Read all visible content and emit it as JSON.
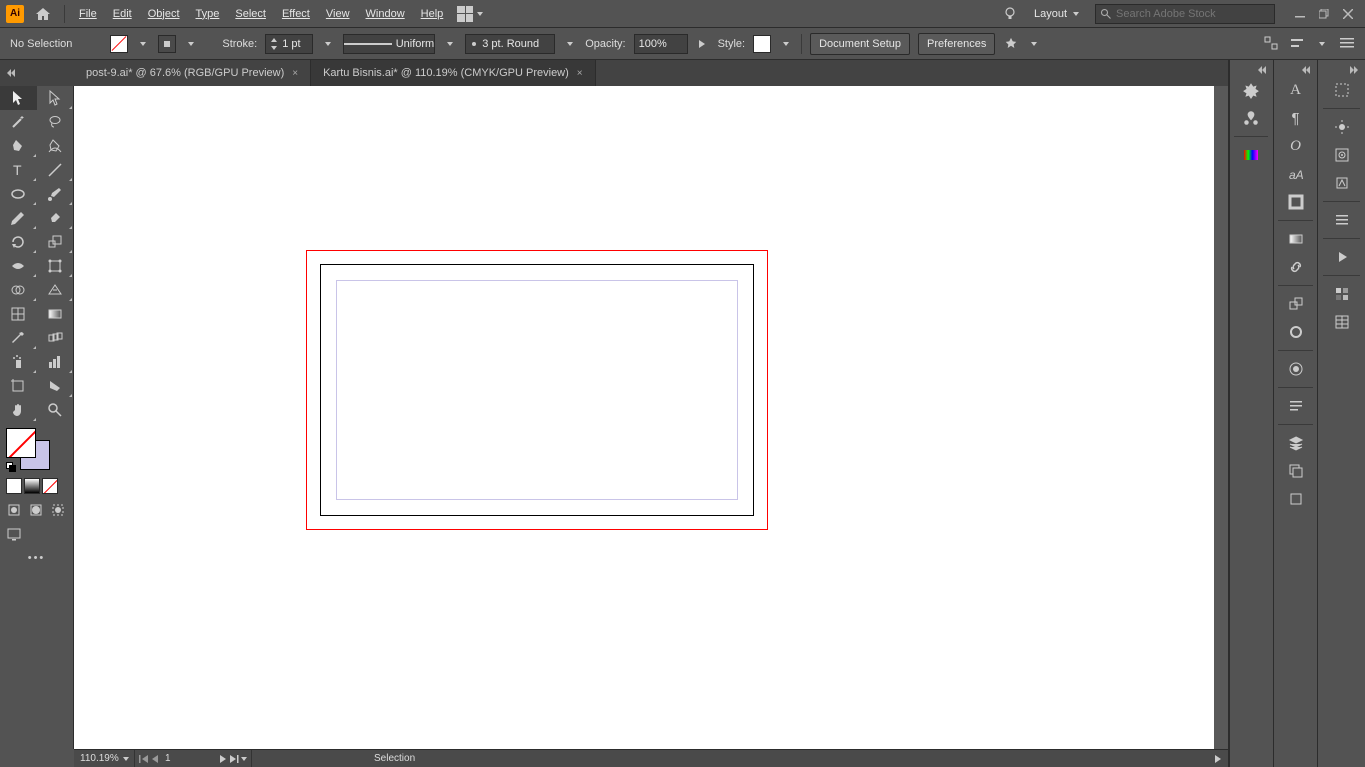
{
  "menu": {
    "items": [
      "File",
      "Edit",
      "Object",
      "Type",
      "Select",
      "Effect",
      "View",
      "Window",
      "Help"
    ],
    "layout_label": "Layout",
    "search_placeholder": "Search Adobe Stock"
  },
  "ctrl": {
    "selection": "No Selection",
    "stroke_label": "Stroke:",
    "stroke_val": "1 pt",
    "profile": "Uniform",
    "brush": "3 pt. Round",
    "opacity_label": "Opacity:",
    "opacity_val": "100%",
    "style_label": "Style:",
    "doc_setup": "Document Setup",
    "prefs": "Preferences"
  },
  "tabs": {
    "inactive": "post-9.ai* @ 67.6% (RGB/GPU Preview)",
    "active": "Kartu Bisnis.ai* @ 110.19% (CMYK/GPU Preview)"
  },
  "status": {
    "zoom": "110.19%",
    "artboard": "1",
    "tool": "Selection"
  },
  "tools_left": [
    [
      "selection",
      "direct-selection"
    ],
    [
      "magic-wand",
      "lasso"
    ],
    [
      "pen",
      "curvature"
    ],
    [
      "type",
      "line"
    ],
    [
      "ellipse",
      "paintbrush"
    ],
    [
      "shaper",
      "eraser"
    ],
    [
      "rotate",
      "scale"
    ],
    [
      "width",
      "free-transform"
    ],
    [
      "shape-builder",
      "perspective"
    ],
    [
      "mesh",
      "gradient"
    ],
    [
      "eyedropper",
      "blend"
    ],
    [
      "symbol-sprayer",
      "column-graph"
    ],
    [
      "artboard",
      "slice"
    ],
    [
      "hand",
      "zoom"
    ]
  ],
  "panels": {
    "col1": [
      "properties",
      "libraries",
      "color"
    ],
    "col2": [
      "character",
      "paragraph",
      "opentype",
      "glyphs",
      "stroke",
      "gradient",
      "transparency",
      "align",
      "pathfinder"
    ],
    "col3": [
      "transform",
      "appearance",
      "graphic-styles",
      "layers",
      "asset-export",
      "artboards",
      "links",
      "actions",
      "symbols",
      "brushes",
      "swatches",
      "color-guide"
    ]
  }
}
